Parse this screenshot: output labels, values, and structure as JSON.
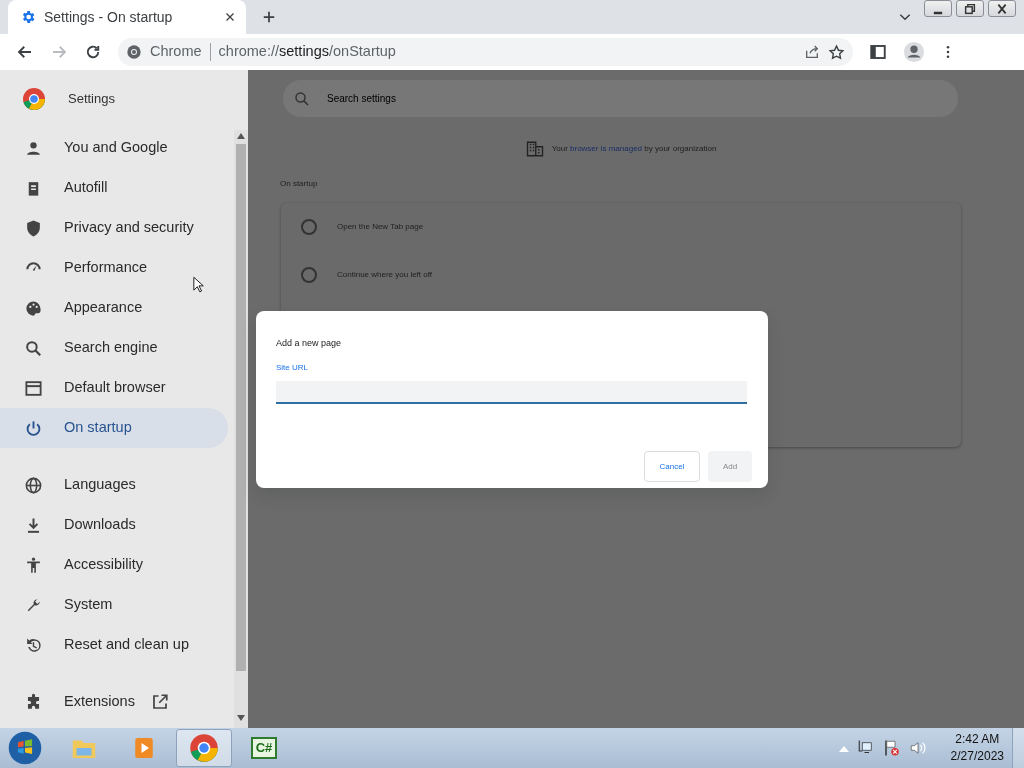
{
  "browser": {
    "tab": {
      "title": "Settings - On startup",
      "selected": true
    },
    "address": {
      "site_label": "Chrome",
      "url_prefix": "chrome://",
      "url_host": "settings",
      "url_path": "/onStartup"
    }
  },
  "settings": {
    "title": "Settings",
    "search": {
      "placeholder": "Search settings"
    },
    "sidebar": {
      "groups": [
        [
          {
            "label": "You and Google",
            "selected": false,
            "external": false
          },
          {
            "label": "Autofill",
            "selected": false,
            "external": false
          },
          {
            "label": "Privacy and security",
            "selected": false,
            "external": false
          },
          {
            "label": "Performance",
            "selected": false,
            "external": false
          },
          {
            "label": "Appearance",
            "selected": false,
            "external": false
          },
          {
            "label": "Search engine",
            "selected": false,
            "external": false
          },
          {
            "label": "Default browser",
            "selected": false,
            "external": false
          },
          {
            "label": "On startup",
            "selected": true,
            "external": false
          }
        ],
        [
          {
            "label": "Languages",
            "selected": false,
            "external": false
          },
          {
            "label": "Downloads",
            "selected": false,
            "external": false
          },
          {
            "label": "Accessibility",
            "selected": false,
            "external": false
          },
          {
            "label": "System",
            "selected": false,
            "external": false
          },
          {
            "label": "Reset and clean up",
            "selected": false,
            "external": false
          }
        ],
        [
          {
            "label": "Extensions",
            "selected": false,
            "external": true
          }
        ]
      ]
    },
    "managed_notice": {
      "before": "Your ",
      "link": "browser is managed",
      "after": " by your organization"
    },
    "section_title": "On startup",
    "options": [
      {
        "label": "Open the New Tab page",
        "selected": false
      },
      {
        "label": "Continue where you left off",
        "selected": false
      }
    ]
  },
  "dialog": {
    "title": "Add a new page",
    "field": {
      "label": "Site URL"
    },
    "buttons": [
      {
        "label": "Cancel",
        "kind": "secondary",
        "disabled": false
      },
      {
        "label": "Add",
        "kind": "primary",
        "disabled": true
      }
    ]
  },
  "taskbar": {
    "apps": [
      {
        "active": false
      },
      {
        "active": false
      },
      {
        "active": true
      },
      {
        "active": false,
        "label": "C#"
      }
    ],
    "time": "2:42 AM",
    "date": "2/27/2023"
  }
}
